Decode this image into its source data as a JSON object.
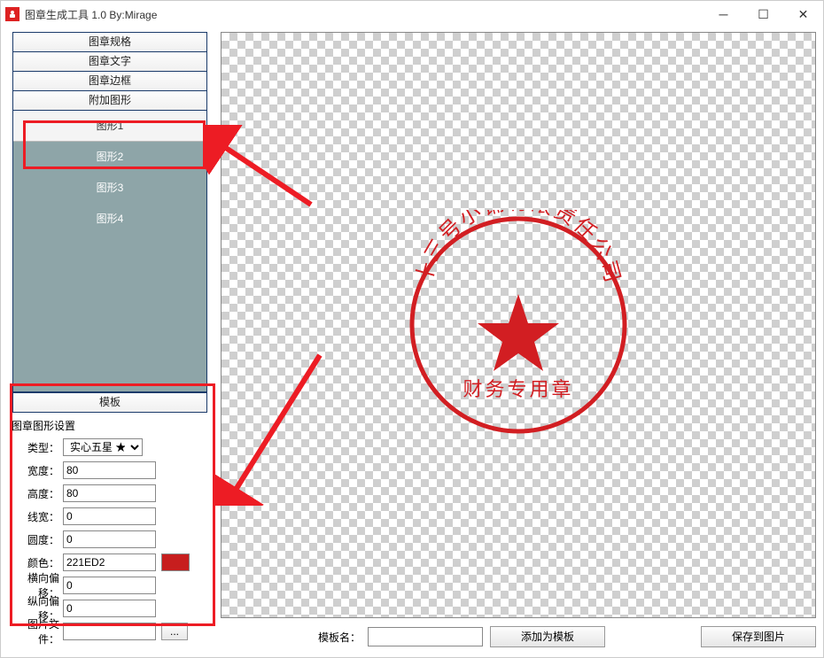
{
  "window": {
    "title": "图章生成工具 1.0    By:Mirage"
  },
  "nav": {
    "spec": "图章规格",
    "text": "图章文字",
    "border": "图章边框",
    "extra": "附加图形",
    "template": "模板"
  },
  "shapes": {
    "s1": "图形1",
    "s2": "图形2",
    "s3": "图形3",
    "s4": "图形4"
  },
  "settings": {
    "title": "图章图形设置",
    "type_label": "类型：",
    "type_value": "实心五星 ★",
    "width_label": "宽度：",
    "width_value": "80",
    "height_label": "高度：",
    "height_value": "80",
    "linew_label": "线宽：",
    "linew_value": "0",
    "round_label": "圆度：",
    "round_value": "0",
    "color_label": "颜色：",
    "color_value": "221ED2",
    "hoff_label": "横向偏移：",
    "hoff_value": "0",
    "voff_label": "纵向偏移：",
    "voff_value": "0",
    "file_label": "图片文件：",
    "file_value": "",
    "browse": "..."
  },
  "stamp": {
    "top_text": "十三号小铺有限责任公司",
    "bottom_text": "财务专用章",
    "color": "#d21e22"
  },
  "bottom": {
    "tpl_label": "模板名：",
    "tpl_value": "",
    "add": "添加为模板",
    "save": "保存到图片"
  }
}
